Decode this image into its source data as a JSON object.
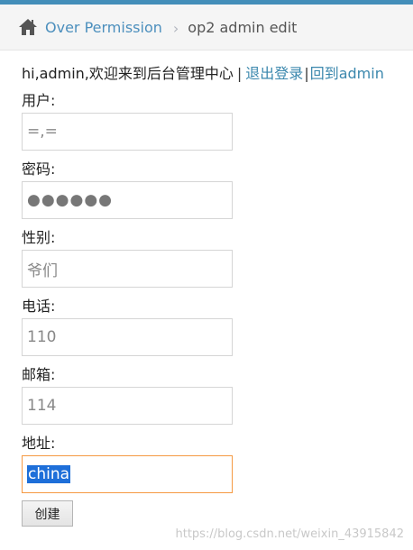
{
  "breadcrumb": {
    "home_icon": "home-icon",
    "link_label": "Over Permission",
    "current_label": "op2 admin edit"
  },
  "welcome": {
    "greeting": "hi,admin,欢迎来到后台管理中心",
    "separator1": "|",
    "logout_label": "退出登录",
    "separator2": "|",
    "back_label": "回到admin"
  },
  "form": {
    "username_label": "用户:",
    "username_value": "=,=",
    "password_label": "密码:",
    "password_value": "●●●●●●",
    "gender_label": "性别:",
    "gender_value": "爷们",
    "phone_label": "电话:",
    "phone_value": "110",
    "email_label": "邮箱:",
    "email_value": "114",
    "address_label": "地址:",
    "address_value": "china",
    "submit_label": "创建"
  },
  "watermark": "https://blog.csdn.net/weixin_43915842",
  "colors": {
    "accent": "#438eb9",
    "link": "#4c8fbd",
    "focus_border": "#f59942",
    "selection": "#1e6fd9"
  }
}
